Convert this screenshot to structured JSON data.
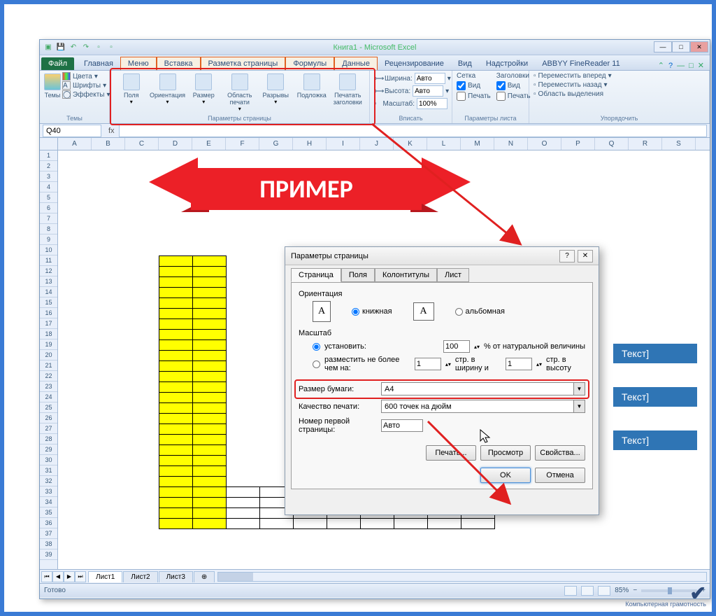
{
  "window": {
    "title": "Книга1 - Microsoft Excel"
  },
  "tabs": {
    "file": "Файл",
    "home": "Главная",
    "menu": "Меню",
    "insert": "Вставка",
    "pagelayout": "Разметка страницы",
    "formulas": "Формулы",
    "data": "Данные",
    "review": "Рецензирование",
    "view": "Вид",
    "addins": "Надстройки",
    "abbyy": "ABBYY FineReader 11"
  },
  "ribbon": {
    "themes": {
      "colors": "Цвета",
      "fonts": "Шрифты",
      "effects": "Эффекты",
      "themes_btn": "Темы",
      "group": "Темы"
    },
    "page_setup": {
      "margins": "Поля",
      "orientation": "Ориентация",
      "size": "Размер",
      "print_area": "Область печати",
      "breaks": "Разрывы",
      "background": "Подложка",
      "print_titles": "Печатать заголовки",
      "group": "Параметры страницы"
    },
    "scale": {
      "width": "Ширина:",
      "height": "Высота:",
      "scale": "Масштаб:",
      "auto": "Авто",
      "percent": "100%",
      "group": "Вписать"
    },
    "sheet_opts": {
      "gridlines": "Сетка",
      "headings": "Заголовки",
      "view": "Вид",
      "print": "Печать",
      "group": "Параметры листа"
    },
    "arrange": {
      "bring_fwd": "Переместить вперед",
      "send_back": "Переместить назад",
      "selection_pane": "Область выделения",
      "group": "Упорядочить"
    }
  },
  "namebox": "Q40",
  "columns": [
    "A",
    "B",
    "C",
    "D",
    "E",
    "F",
    "G",
    "H",
    "I",
    "J",
    "K",
    "L",
    "M",
    "N",
    "O",
    "P",
    "Q",
    "R",
    "S"
  ],
  "banner_text": "ПРИМЕР",
  "blue_text": "Текст]",
  "sheets": {
    "s1": "Лист1",
    "s2": "Лист2",
    "s3": "Лист3"
  },
  "status": {
    "ready": "Готово",
    "zoom": "85%"
  },
  "dialog": {
    "title": "Параметры страницы",
    "tabs": {
      "page": "Страница",
      "margins": "Поля",
      "headerfooter": "Колонтитулы",
      "sheet": "Лист"
    },
    "orientation_label": "Ориентация",
    "portrait": "книжная",
    "landscape": "альбомная",
    "scale_label": "Масштаб",
    "set_to": "установить:",
    "set_pct": "100",
    "set_suffix": "% от натуральной величины",
    "fit_to": "разместить не более чем на:",
    "fit_w": "1",
    "fit_mid": "стр. в ширину и",
    "fit_h": "1",
    "fit_suffix": "стр. в высоту",
    "paper_size": "Размер бумаги:",
    "paper_value": "A4",
    "print_quality": "Качество печати:",
    "print_quality_value": "600 точек на дюйм",
    "first_page": "Номер первой страницы:",
    "first_page_value": "Авто",
    "btn_print": "Печать...",
    "btn_preview": "Просмотр",
    "btn_props": "Свойства...",
    "ok": "OK",
    "cancel": "Отмена"
  },
  "watermark": {
    "l1": "Компьютерная грамотность"
  }
}
